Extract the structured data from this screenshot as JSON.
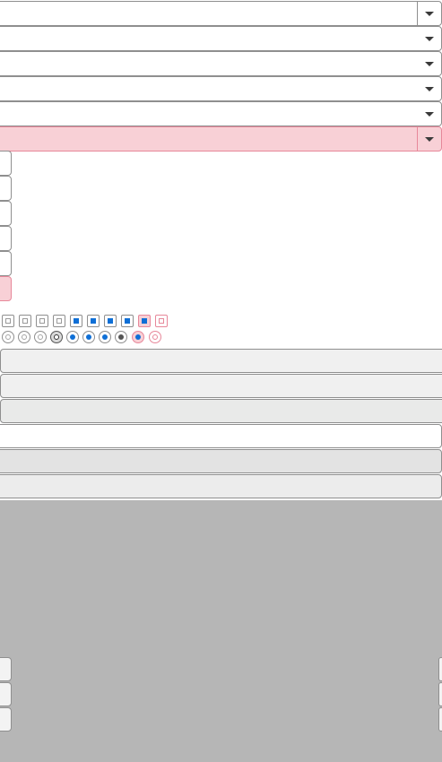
{
  "selects": [
    {
      "value": "",
      "state": "normal"
    },
    {
      "value": "",
      "state": "normal"
    },
    {
      "value": "",
      "state": "normal"
    },
    {
      "value": "",
      "state": "normal"
    },
    {
      "value": "",
      "state": "normal"
    },
    {
      "value": "",
      "state": "error"
    }
  ],
  "stub_inputs": [
    {
      "value": "",
      "state": "normal"
    },
    {
      "value": "",
      "state": "normal"
    },
    {
      "value": "",
      "state": "normal"
    },
    {
      "value": "",
      "state": "normal"
    },
    {
      "value": "",
      "state": "normal"
    },
    {
      "value": "",
      "state": "error"
    }
  ],
  "checkboxes": [
    {
      "checked": false,
      "state": "normal"
    },
    {
      "checked": false,
      "state": "hover"
    },
    {
      "checked": false,
      "state": "disabled"
    },
    {
      "checked": false,
      "state": "focus"
    },
    {
      "checked": true,
      "state": "normal"
    },
    {
      "checked": true,
      "state": "hover"
    },
    {
      "checked": true,
      "state": "active"
    },
    {
      "checked": true,
      "state": "focus"
    },
    {
      "checked": true,
      "state": "error"
    },
    {
      "checked": false,
      "state": "error"
    }
  ],
  "radios": [
    {
      "checked": false,
      "state": "normal"
    },
    {
      "checked": false,
      "state": "hover"
    },
    {
      "checked": false,
      "state": "disabled"
    },
    {
      "checked": false,
      "state": "active"
    },
    {
      "checked": true,
      "state": "normal"
    },
    {
      "checked": true,
      "state": "hover"
    },
    {
      "checked": true,
      "state": "active"
    },
    {
      "checked": true,
      "state": "dark"
    },
    {
      "checked": true,
      "state": "error"
    },
    {
      "checked": false,
      "state": "error"
    }
  ],
  "buttons": [
    {
      "label": "",
      "style": "default"
    },
    {
      "label": "",
      "style": "default"
    },
    {
      "label": "",
      "style": "dim"
    },
    {
      "label": "",
      "style": "white"
    },
    {
      "label": "",
      "style": "grey"
    },
    {
      "label": "",
      "style": "flat"
    }
  ],
  "grey_panel_controls": [
    {
      "label": ""
    },
    {
      "label": ""
    },
    {
      "label": ""
    }
  ],
  "colors": {
    "accent": "#0f6fd6",
    "border": "#8f8f8f",
    "error_bg": "#f8d0d6",
    "error_border": "#e7889a",
    "panel_grey": "#b6b6b6"
  }
}
